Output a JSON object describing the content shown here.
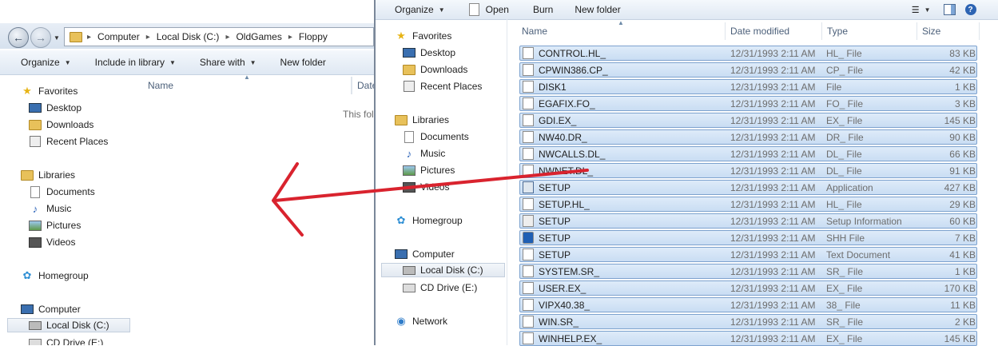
{
  "left_window": {
    "breadcrumb": [
      "Computer",
      "Local Disk (C:)",
      "OldGames",
      "Floppy"
    ],
    "toolbar": {
      "organize": "Organize",
      "include": "Include in library",
      "share": "Share with",
      "newfolder": "New folder"
    },
    "columns": {
      "name": "Name",
      "date": "Date"
    },
    "empty_text": "This fol",
    "nav": {
      "favorites": "Favorites",
      "desktop": "Desktop",
      "downloads": "Downloads",
      "recent": "Recent Places",
      "libraries": "Libraries",
      "documents": "Documents",
      "music": "Music",
      "pictures": "Pictures",
      "videos": "Videos",
      "homegroup": "Homegroup",
      "computer": "Computer",
      "localdisk": "Local Disk (C:)",
      "cddrive": "CD Drive (E:)"
    }
  },
  "right_window": {
    "toolbar": {
      "organize": "Organize",
      "open": "Open",
      "burn": "Burn",
      "newfolder": "New folder"
    },
    "columns": {
      "name": "Name",
      "date": "Date modified",
      "type": "Type",
      "size": "Size"
    },
    "nav": {
      "favorites": "Favorites",
      "desktop": "Desktop",
      "downloads": "Downloads",
      "recent": "Recent Places",
      "libraries": "Libraries",
      "documents": "Documents",
      "music": "Music",
      "pictures": "Pictures",
      "videos": "Videos",
      "homegroup": "Homegroup",
      "computer": "Computer",
      "localdisk": "Local Disk (C:)",
      "cddrive": "CD Drive (E:)",
      "network": "Network"
    },
    "files": [
      {
        "name": "CONTROL.HL_",
        "date": "12/31/1993 2:11 AM",
        "type": "HL_ File",
        "size": "83 KB",
        "icon": "file-icon"
      },
      {
        "name": "CPWIN386.CP_",
        "date": "12/31/1993 2:11 AM",
        "type": "CP_ File",
        "size": "42 KB",
        "icon": "file-icon"
      },
      {
        "name": "DISK1",
        "date": "12/31/1993 2:11 AM",
        "type": "File",
        "size": "1 KB",
        "icon": "file-icon"
      },
      {
        "name": "EGAFIX.FO_",
        "date": "12/31/1993 2:11 AM",
        "type": "FO_ File",
        "size": "3 KB",
        "icon": "file-icon"
      },
      {
        "name": "GDI.EX_",
        "date": "12/31/1993 2:11 AM",
        "type": "EX_ File",
        "size": "145 KB",
        "icon": "file-icon"
      },
      {
        "name": "NW40.DR_",
        "date": "12/31/1993 2:11 AM",
        "type": "DR_ File",
        "size": "90 KB",
        "icon": "file-icon"
      },
      {
        "name": "NWCALLS.DL_",
        "date": "12/31/1993 2:11 AM",
        "type": "DL_ File",
        "size": "66 KB",
        "icon": "file-icon"
      },
      {
        "name": "NWNET.DL_",
        "date": "12/31/1993 2:11 AM",
        "type": "DL_ File",
        "size": "91 KB",
        "icon": "file-icon"
      },
      {
        "name": "SETUP",
        "date": "12/31/1993 2:11 AM",
        "type": "Application",
        "size": "427 KB",
        "icon": "application-icon"
      },
      {
        "name": "SETUP.HL_",
        "date": "12/31/1993 2:11 AM",
        "type": "HL_ File",
        "size": "29 KB",
        "icon": "file-icon"
      },
      {
        "name": "SETUP",
        "date": "12/31/1993 2:11 AM",
        "type": "Setup Information",
        "size": "60 KB",
        "icon": "setup-info-icon"
      },
      {
        "name": "SETUP",
        "date": "12/31/1993 2:11 AM",
        "type": "SHH File",
        "size": "7 KB",
        "icon": "shh-icon"
      },
      {
        "name": "SETUP",
        "date": "12/31/1993 2:11 AM",
        "type": "Text Document",
        "size": "41 KB",
        "icon": "text-document-icon"
      },
      {
        "name": "SYSTEM.SR_",
        "date": "12/31/1993 2:11 AM",
        "type": "SR_ File",
        "size": "1 KB",
        "icon": "file-icon"
      },
      {
        "name": "USER.EX_",
        "date": "12/31/1993 2:11 AM",
        "type": "EX_ File",
        "size": "170 KB",
        "icon": "file-icon"
      },
      {
        "name": "VIPX40.38_",
        "date": "12/31/1993 2:11 AM",
        "type": "38_ File",
        "size": "11 KB",
        "icon": "file-icon"
      },
      {
        "name": "WIN.SR_",
        "date": "12/31/1993 2:11 AM",
        "type": "SR_ File",
        "size": "2 KB",
        "icon": "file-icon"
      },
      {
        "name": "WINHELP.EX_",
        "date": "12/31/1993 2:11 AM",
        "type": "EX_ File",
        "size": "145 KB",
        "icon": "file-icon"
      }
    ]
  },
  "annotation": {
    "arrow_color": "#d9232e"
  }
}
